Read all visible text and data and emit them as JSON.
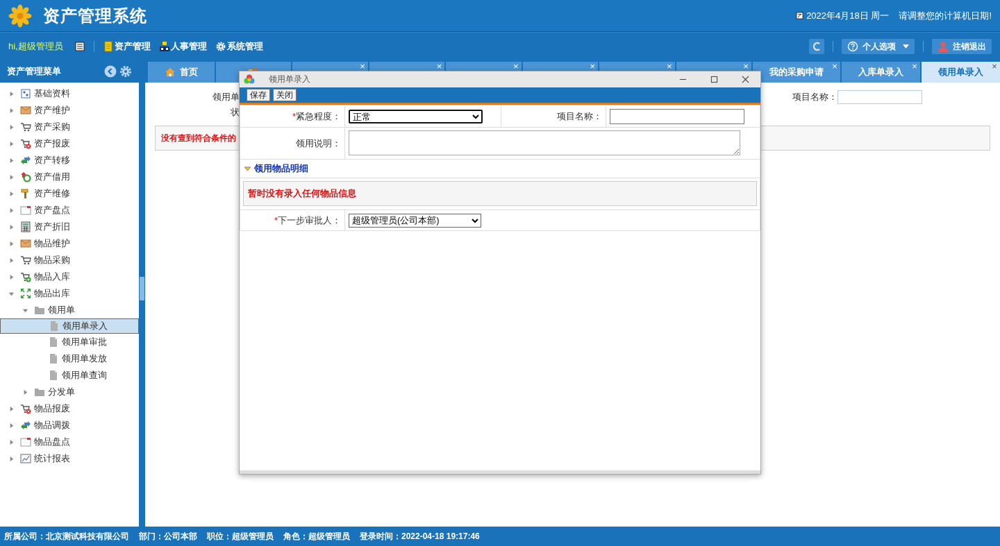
{
  "header": {
    "title": "资产管理系统",
    "date": "2022年4月18日 周一",
    "notice": "请调整您的计算机日期!"
  },
  "nav": {
    "greeting": "hi,超级管理员",
    "menus": [
      {
        "label": "资产管理"
      },
      {
        "label": "人事管理"
      },
      {
        "label": "系统管理"
      }
    ],
    "options_label": "个人选项",
    "logout_label": "注销退出"
  },
  "sidebar": {
    "title": "资产管理菜单",
    "items": [
      {
        "label": "基础资料",
        "expanded": false,
        "selected": false
      },
      {
        "label": "资产维护",
        "expanded": false,
        "selected": false
      },
      {
        "label": "资产采购",
        "expanded": false,
        "selected": false
      },
      {
        "label": "资产报废",
        "expanded": false,
        "selected": false
      },
      {
        "label": "资产转移",
        "expanded": false,
        "selected": false
      },
      {
        "label": "资产借用",
        "expanded": false,
        "selected": false
      },
      {
        "label": "资产维修",
        "expanded": false,
        "selected": false
      },
      {
        "label": "资产盘点",
        "expanded": false,
        "selected": false
      },
      {
        "label": "资产折旧",
        "expanded": false,
        "selected": false
      },
      {
        "label": "物品维护",
        "expanded": false,
        "selected": false
      },
      {
        "label": "物品采购",
        "expanded": false,
        "selected": false
      },
      {
        "label": "物品入库",
        "expanded": false,
        "selected": false
      },
      {
        "label": "物品出库",
        "expanded": true,
        "selected": false,
        "children": [
          {
            "label": "领用单",
            "expanded": true,
            "selected": false,
            "children": [
              {
                "label": "领用单录入",
                "selected": true
              },
              {
                "label": "领用单审批",
                "selected": false
              },
              {
                "label": "领用单发放",
                "selected": false
              },
              {
                "label": "领用单查询",
                "selected": false
              }
            ]
          },
          {
            "label": "分发单",
            "expanded": false,
            "selected": false
          }
        ]
      },
      {
        "label": "物品报废",
        "expanded": false,
        "selected": false
      },
      {
        "label": "物品调拨",
        "expanded": false,
        "selected": false
      },
      {
        "label": "物品盘点",
        "expanded": false,
        "selected": false
      },
      {
        "label": "统计报表",
        "expanded": false,
        "selected": false
      }
    ]
  },
  "tabs": [
    {
      "label": "首页",
      "selected": false
    },
    {
      "selected": false
    },
    {
      "selected": false,
      "close": "×"
    },
    {
      "selected": false,
      "close": "×"
    },
    {
      "selected": false,
      "close": "×"
    },
    {
      "selected": false,
      "close": "×"
    },
    {
      "selected": false,
      "close": "×"
    },
    {
      "selected": false,
      "close": "×"
    },
    {
      "label": "我的采购申请",
      "selected": false,
      "close": "×"
    },
    {
      "label": "入库单录入",
      "selected": false,
      "close": "×"
    },
    {
      "label": "领用单录入",
      "selected": true,
      "close": "×"
    }
  ],
  "background_form": {
    "fields": [
      {
        "label": "领用单"
      },
      {
        "label": "状"
      }
    ],
    "project_label": "项目名称：",
    "message": "没有查到符合条件的"
  },
  "dialog": {
    "title": "领用单录入",
    "buttons": [
      "保存",
      "关闭"
    ],
    "urgency": {
      "required_mark": "*",
      "label": "紧急程度：",
      "value": "正常"
    },
    "project": {
      "label": "项目名称："
    },
    "description": {
      "label": "领用说明："
    },
    "section_title": "领用物品明细",
    "empty_message": "暂时没有录入任何物品信息",
    "approver": {
      "required_mark": "*",
      "label": "下一步审批人：",
      "value": "超级管理员(公司本部)"
    }
  },
  "status_bar": [
    "所属公司：北京测试科技有限公司",
    "部门：公司本部",
    "职位：超级管理员",
    "角色：超级管理员",
    "登录时间：2022-04-18 19:17:46"
  ]
}
